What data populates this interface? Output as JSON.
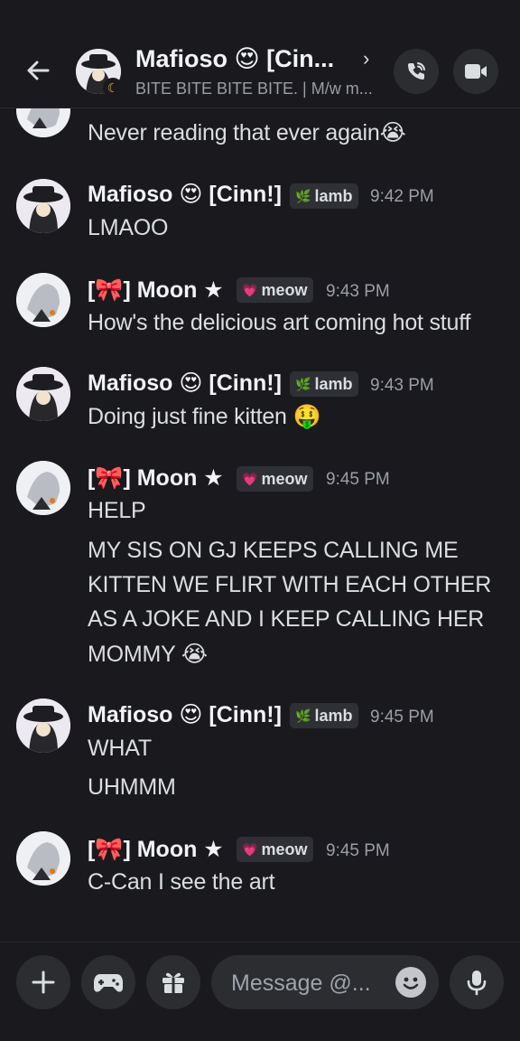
{
  "header": {
    "title": "Mafioso 😍 [Cin...",
    "subtitle": "BITE BITE BITE BITE. | M/w m...",
    "icons": [
      "back-arrow-icon",
      "chevron-right-icon",
      "phone-call-icon",
      "video-camera-icon"
    ]
  },
  "partial": {
    "text": "Never reading that ever again",
    "emoji": "😭"
  },
  "messages": [
    {
      "name": "Mafioso 😍 [Cinn!]",
      "tag_icon": "🌿",
      "tag": "lamb",
      "time": "9:42 PM",
      "lines": [
        "LMAOO"
      ]
    },
    {
      "name": "[🎀] Moon ★",
      "tag_icon": "💗",
      "tag": "meow",
      "time": "9:43 PM",
      "lines": [
        "How's the delicious art coming hot stuff"
      ]
    },
    {
      "name": "Mafioso 😍 [Cinn!]",
      "tag_icon": "🌿",
      "tag": "lamb",
      "time": "9:43 PM",
      "lines": [
        "Doing just fine kitten 🤑"
      ]
    },
    {
      "name": "[🎀] Moon ★",
      "tag_icon": "💗",
      "tag": "meow",
      "time": "9:45 PM",
      "lines": [
        "HELP",
        "MY SIS ON GJ KEEPS CALLING ME",
        "KITTEN WE FLIRT WITH EACH OTHER",
        "AS A JOKE AND I KEEP CALLING HER",
        "MOMMY 😭"
      ]
    },
    {
      "name": "Mafioso 😍 [Cinn!]",
      "tag_icon": "🌿",
      "tag": "lamb",
      "time": "9:45 PM",
      "lines": [
        "WHAT",
        "UHMMM"
      ]
    },
    {
      "name": "[🎀] Moon ★",
      "tag_icon": "💗",
      "tag": "meow",
      "time": "9:45 PM",
      "lines": [
        "C-Can I see the art"
      ]
    }
  ],
  "composer": {
    "placeholder": "Message @...",
    "icons": [
      "plus-icon",
      "gamepad-icon",
      "gift-icon",
      "emoji-icon",
      "microphone-icon"
    ]
  }
}
